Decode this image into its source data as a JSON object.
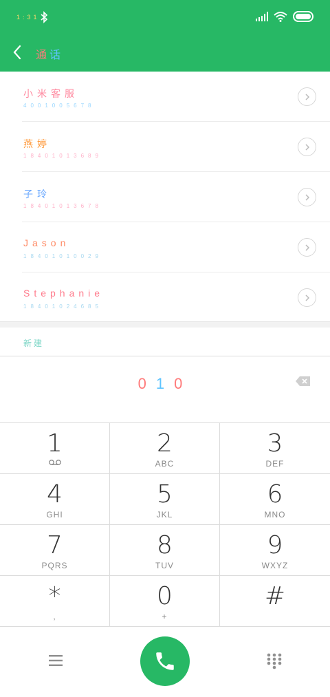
{
  "status_bar": {
    "time": "1:31"
  },
  "header": {
    "title_part1": "通",
    "title_part2": "话"
  },
  "results": [
    {
      "name": "小米客服",
      "number": "4001005678",
      "name_color": "#ff8aa0",
      "number_color": "#9ad7ff"
    },
    {
      "name": "燕婷",
      "number": "18401013689",
      "name_color": "#ff9a3c",
      "number_color": "#ffb0c8"
    },
    {
      "name": "子玲",
      "number": "18401013678",
      "name_color": "#6aa8ff",
      "number_color": "#ffb0c8"
    },
    {
      "name": "Jason",
      "number": "18401010029",
      "name_color": "#ff8a65",
      "number_color": "#a7d8f0"
    },
    {
      "name": "Stephanie",
      "number": "18401024685",
      "name_color": "#ff7b8c",
      "number_color": "#a7d8f0"
    }
  ],
  "new_contact_label": "新建",
  "dialed_number": "010",
  "keypad": [
    {
      "digit": "1",
      "letters": ""
    },
    {
      "digit": "2",
      "letters": "ABC"
    },
    {
      "digit": "3",
      "letters": "DEF"
    },
    {
      "digit": "4",
      "letters": "GHI"
    },
    {
      "digit": "5",
      "letters": "JKL"
    },
    {
      "digit": "6",
      "letters": "MNO"
    },
    {
      "digit": "7",
      "letters": "PQRS"
    },
    {
      "digit": "8",
      "letters": "TUV"
    },
    {
      "digit": "9",
      "letters": "WXYZ"
    },
    {
      "digit": "*",
      "letters": ","
    },
    {
      "digit": "0",
      "letters": "+"
    },
    {
      "digit": "#",
      "letters": ""
    }
  ],
  "icons": {
    "back": "chevron-left-icon",
    "detail": "chevron-right-icon",
    "backspace": "backspace-icon",
    "voicemail": "voicemail-icon",
    "menu": "menu-icon",
    "call": "phone-icon",
    "keypad": "dialpad-icon"
  },
  "colors": {
    "accent": "#27b865"
  }
}
